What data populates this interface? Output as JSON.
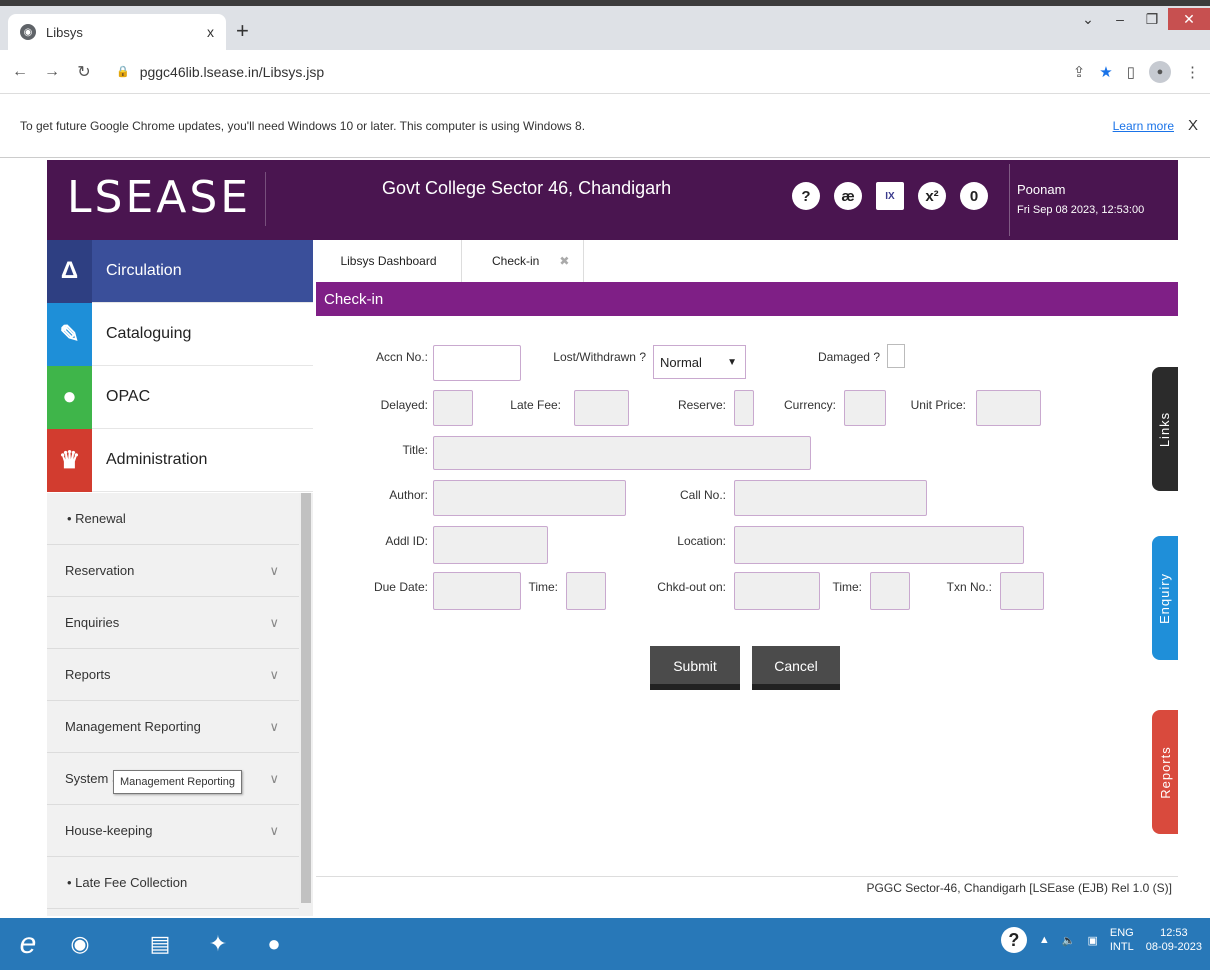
{
  "browser": {
    "tab_title": "Libsys",
    "tab_close": "x",
    "new_tab": "+",
    "url": "pggc46lib.lsease.in/Libsys.jsp",
    "infobar_text": "To get future Google Chrome updates, you'll need Windows 10 or later. This computer is using Windows 8.",
    "learn_more": "Learn more",
    "infobar_close": "X"
  },
  "header": {
    "logo": "LSEASE",
    "college": "Govt College Sector 46, Chandigarh",
    "icons": [
      "?",
      "ӕ",
      "IX",
      "x²",
      "0"
    ],
    "user_name": "Poonam",
    "datetime": "Fri Sep 08 2023, 12:53:00"
  },
  "sidebar": {
    "modules": [
      {
        "label": "Circulation",
        "color": "#2e3f82",
        "icon": "Δ"
      },
      {
        "label": "Cataloguing",
        "color": "#1e8fd8",
        "icon": "✎"
      },
      {
        "label": "OPAC",
        "color": "#3fb54a",
        "icon": "●"
      },
      {
        "label": "Administration",
        "color": "#d23c2f",
        "icon": "♛"
      }
    ],
    "items": [
      {
        "label": "• Renewal"
      },
      {
        "label": "Reservation"
      },
      {
        "label": "Enquiries"
      },
      {
        "label": "Reports"
      },
      {
        "label": "Management Reporting"
      },
      {
        "label": "System Set"
      },
      {
        "label": "House-keeping"
      },
      {
        "label": "• Late Fee Collection"
      }
    ],
    "chevron": "∨",
    "tooltip": "Management Reporting"
  },
  "main": {
    "tabs": [
      {
        "label": "Libsys Dashboard"
      },
      {
        "label": "Check-in",
        "close": "✖"
      }
    ],
    "title": "Check-in",
    "form": {
      "accn_no": "Accn No.:",
      "lost_withdrawn": "Lost/Withdrawn ?",
      "lost_value": "Normal",
      "damaged": "Damaged ?",
      "delayed": "Delayed:",
      "late_fee": "Late Fee:",
      "reserve": "Reserve:",
      "currency": "Currency:",
      "unit_price": "Unit Price:",
      "title": "Title:",
      "author": "Author:",
      "call_no": "Call No.:",
      "addl_id": "Addl ID:",
      "location": "Location:",
      "due_date": "Due Date:",
      "time1": "Time:",
      "chkd_out_on": "Chkd-out on:",
      "time2": "Time:",
      "txn_no": "Txn No.:"
    },
    "submit": "Submit",
    "cancel": "Cancel",
    "footer": "PGGC Sector-46, Chandigarh [LSEase (EJB) Rel 1.0 (S)]"
  },
  "side_tabs": [
    {
      "label": "Links",
      "color": "#2b2b2b"
    },
    {
      "label": "Enquiry",
      "color": "#1f8fd9"
    },
    {
      "label": "Reports",
      "color": "#d94a3d"
    }
  ],
  "taskbar": {
    "lang_top": "ENG",
    "lang_bottom": "INTL",
    "time": "12:53",
    "date": "08-09-2023"
  }
}
